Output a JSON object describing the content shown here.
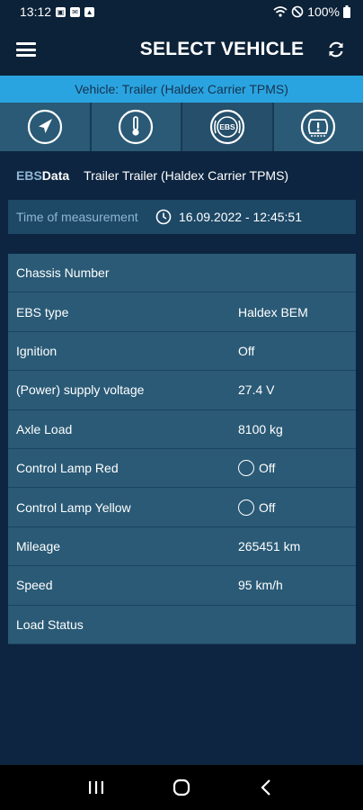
{
  "status_bar": {
    "time": "13:12",
    "battery": "100%"
  },
  "app_bar": {
    "title": "SELECT VEHICLE"
  },
  "vehicle_banner": "Vehicle: Trailer (Haldex Carrier TPMS)",
  "tabs": [
    {
      "icon": "navigation-icon",
      "active": false
    },
    {
      "icon": "thermometer-icon",
      "active": false
    },
    {
      "icon": "ebs-icon",
      "active": true,
      "label": "EBS"
    },
    {
      "icon": "tpms-icon",
      "active": false
    }
  ],
  "ebs_header": {
    "ebs": "EBS",
    "data": "Data",
    "vehicle": "Trailer Trailer (Haldex Carrier TPMS)"
  },
  "measurement": {
    "label": "Time of measurement",
    "value": "16.09.2022 - 12:45:51"
  },
  "rows": [
    {
      "key": "Chassis Number",
      "value": ""
    },
    {
      "key": "EBS type",
      "value": "Haldex BEM"
    },
    {
      "key": "Ignition",
      "value": "Off"
    },
    {
      "key": "(Power) supply voltage",
      "value": "27.4 V"
    },
    {
      "key": "Axle Load",
      "value": "8100 kg"
    },
    {
      "key": "Control Lamp Red",
      "value": "Off",
      "lamp": true
    },
    {
      "key": "Control Lamp Yellow",
      "value": "Off",
      "lamp": true
    },
    {
      "key": "Mileage",
      "value": "265451 km"
    },
    {
      "key": "Speed",
      "value": "95 km/h"
    },
    {
      "key": "Load Status",
      "value": ""
    }
  ],
  "colors": {
    "background": "#0d2540",
    "banner": "#2aa4e0",
    "row": "#2a5a76",
    "label_accent": "#8fb6d2"
  }
}
